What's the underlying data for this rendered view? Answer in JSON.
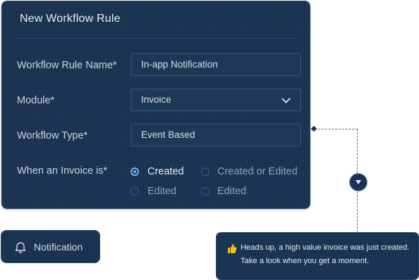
{
  "form": {
    "title": "New Workflow Rule",
    "fields": [
      {
        "label": "Workflow Rule Name*",
        "value": "In-app Notification"
      },
      {
        "label": "Module*",
        "value": "Invoice"
      },
      {
        "label": "Workflow Type*",
        "value": "Event Based"
      }
    ],
    "trigger": {
      "label": "When an Invoice is*",
      "options": [
        {
          "label": "Created",
          "selected": true
        },
        {
          "label": "Created or Edited",
          "selected": false
        },
        {
          "label": "Edited",
          "selected": false
        },
        {
          "label": "Edited",
          "selected": false
        }
      ]
    }
  },
  "notification_button": {
    "label": "Notification",
    "icon": "bell-icon"
  },
  "toast": {
    "icon": "thumbs-up-icon",
    "line1": "Heads up, a high value invoice was just created.",
    "line2": "Take a look when you get a moment."
  },
  "colors": {
    "panel": "#1a3350",
    "accent": "#74b4ee",
    "text": "#e7edf4",
    "emoji": "#f5c400"
  }
}
